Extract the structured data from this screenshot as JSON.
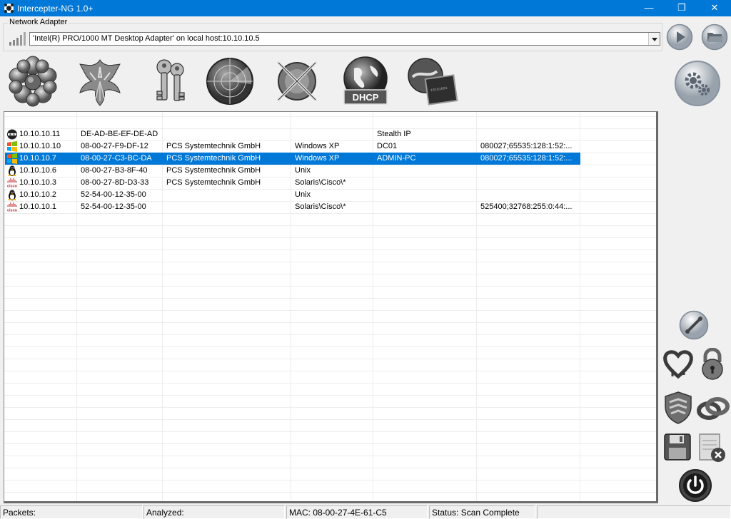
{
  "window": {
    "title": "Intercepter-NG 1.0+"
  },
  "adapter": {
    "legend": "Network Adapter",
    "selected": "'Intel(R) PRO/1000 MT Desktop Adapter' on local host:10.10.10.5"
  },
  "toolbar": {
    "items": [
      {
        "icon": "flower-icon"
      },
      {
        "icon": "phoenix-icon"
      },
      {
        "icon": "keys-icon"
      },
      {
        "icon": "radar-icon"
      },
      {
        "icon": "crossed-swords-icon"
      },
      {
        "icon": "dhcp-globe-icon",
        "label": "DHCP"
      },
      {
        "icon": "network-cable-icon"
      }
    ]
  },
  "hosts": [
    {
      "os_icon": "ninja-icon",
      "ip": "10.10.10.11",
      "mac": "DE-AD-BE-EF-DE-AD",
      "vendor": "",
      "os": "",
      "name": "Stealth IP",
      "fingerprint": "",
      "selected": false
    },
    {
      "os_icon": "windows-icon",
      "ip": "10.10.10.10",
      "mac": "08-00-27-F9-DF-12",
      "vendor": "PCS Systemtechnik GmbH",
      "os": "Windows XP",
      "name": "DC01",
      "fingerprint": "080027;65535:128:1:52:...",
      "selected": false
    },
    {
      "os_icon": "windows-icon",
      "ip": "10.10.10.7",
      "mac": "08-00-27-C3-BC-DA",
      "vendor": "PCS Systemtechnik GmbH",
      "os": "Windows XP",
      "name": "ADMIN-PC",
      "fingerprint": "080027;65535:128:1:52:...",
      "selected": true
    },
    {
      "os_icon": "linux-icon",
      "ip": "10.10.10.6",
      "mac": "08-00-27-B3-8F-40",
      "vendor": "PCS Systemtechnik GmbH",
      "os": "Unix",
      "name": "",
      "fingerprint": "",
      "selected": false
    },
    {
      "os_icon": "cisco-icon",
      "ip": "10.10.10.3",
      "mac": "08-00-27-8D-D3-33",
      "vendor": "PCS Systemtechnik GmbH",
      "os": "Solaris\\Cisco\\*",
      "name": "",
      "fingerprint": "",
      "selected": false
    },
    {
      "os_icon": "linux-icon",
      "ip": "10.10.10.2",
      "mac": "52-54-00-12-35-00",
      "vendor": "",
      "os": "Unix",
      "name": "",
      "fingerprint": "",
      "selected": false
    },
    {
      "os_icon": "cisco-icon",
      "ip": "10.10.10.1",
      "mac": "52-54-00-12-35-00",
      "vendor": "",
      "os": "Solaris\\Cisco\\*",
      "name": "",
      "fingerprint": "525400;32768:255:0:44:...",
      "selected": false
    }
  ],
  "status": {
    "packets": "Packets:",
    "analyzed": "Analyzed:",
    "mac": "MAC: 08-00-27-4E-61-C5",
    "state": "Status: Scan Complete"
  },
  "colors": {
    "titlebar": "#0078d7",
    "selection": "#0078d7"
  }
}
